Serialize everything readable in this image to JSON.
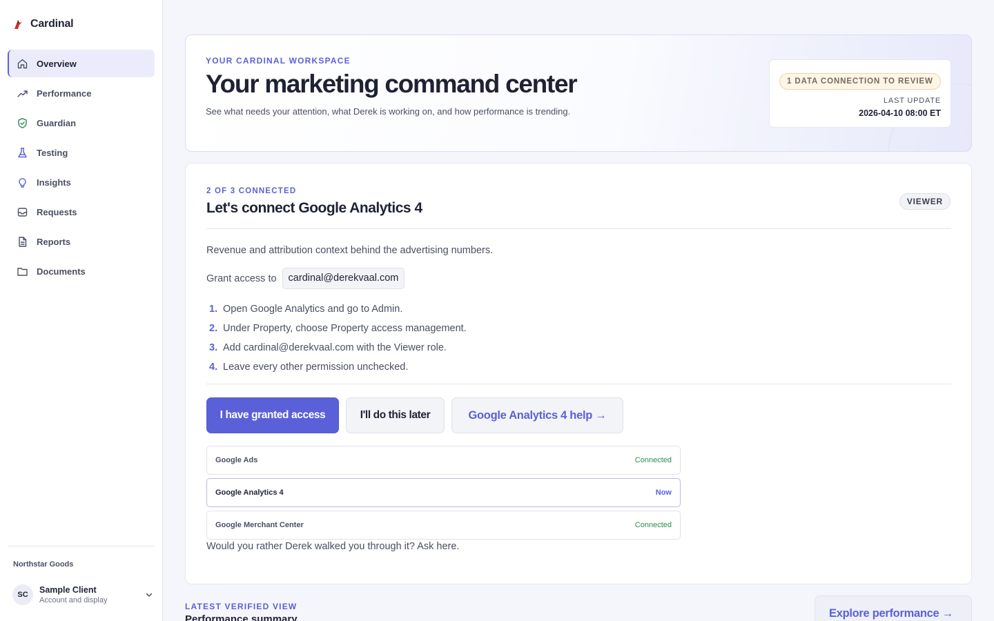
{
  "app": {
    "name": "Cardinal"
  },
  "sidebar": {
    "items": [
      {
        "label": "Overview",
        "icon": "home-icon",
        "active": true
      },
      {
        "label": "Performance",
        "icon": "trend-icon",
        "active": false
      },
      {
        "label": "Guardian",
        "icon": "shield-icon",
        "active": false
      },
      {
        "label": "Testing",
        "icon": "flask-icon",
        "active": false
      },
      {
        "label": "Insights",
        "icon": "lightbulb-icon",
        "active": false
      },
      {
        "label": "Requests",
        "icon": "inbox-icon",
        "active": false
      },
      {
        "label": "Reports",
        "icon": "document-icon",
        "active": false
      },
      {
        "label": "Documents",
        "icon": "folder-icon",
        "active": false
      }
    ],
    "org_name": "Northstar Goods",
    "account": {
      "initials": "SC",
      "name": "Sample Client",
      "subtitle": "Account and display"
    }
  },
  "hero": {
    "eyebrow": "YOUR CARDINAL WORKSPACE",
    "title": "Your marketing command center",
    "subtitle": "See what needs your attention, what Derek is working on, and how performance is trending.",
    "review_pill": "1 DATA CONNECTION TO REVIEW",
    "last_update_label": "LAST UPDATE",
    "last_update_value": "2026-04-10 08:00 ET"
  },
  "connect": {
    "eyebrow": "2 OF 3 CONNECTED",
    "title": "Let's connect Google Analytics 4",
    "role": "VIEWER",
    "description": "Revenue and attribution context behind the advertising numbers.",
    "grant_label": "Grant access to",
    "grant_email": "cardinal@derekvaal.com",
    "steps": [
      {
        "num": "1.",
        "text": "Open Google Analytics and go to Admin."
      },
      {
        "num": "2.",
        "text": "Under Property, choose Property access management."
      },
      {
        "num": "3.",
        "text": "Add cardinal@derekvaal.com with the Viewer role."
      },
      {
        "num": "4.",
        "text": "Leave every other permission unchecked."
      }
    ],
    "primary_button": "I have granted access",
    "secondary_button": "I'll do this later",
    "help_button": "Google Analytics 4 help →",
    "connections": [
      {
        "name": "Google Ads",
        "status": "Connected"
      },
      {
        "name": "Google Analytics 4",
        "status": "Now"
      },
      {
        "name": "Google Merchant Center",
        "status": "Connected"
      }
    ],
    "ask_link": "Would you rather Derek walked you through it? Ask here."
  },
  "latest": {
    "eyebrow": "LATEST VERIFIED VIEW",
    "title": "Performance summary",
    "explore_button": "Explore performance →"
  },
  "colors": {
    "accent": "#5a61d8",
    "connected": "#2c8a52",
    "review_border": "#f1d3a2"
  }
}
